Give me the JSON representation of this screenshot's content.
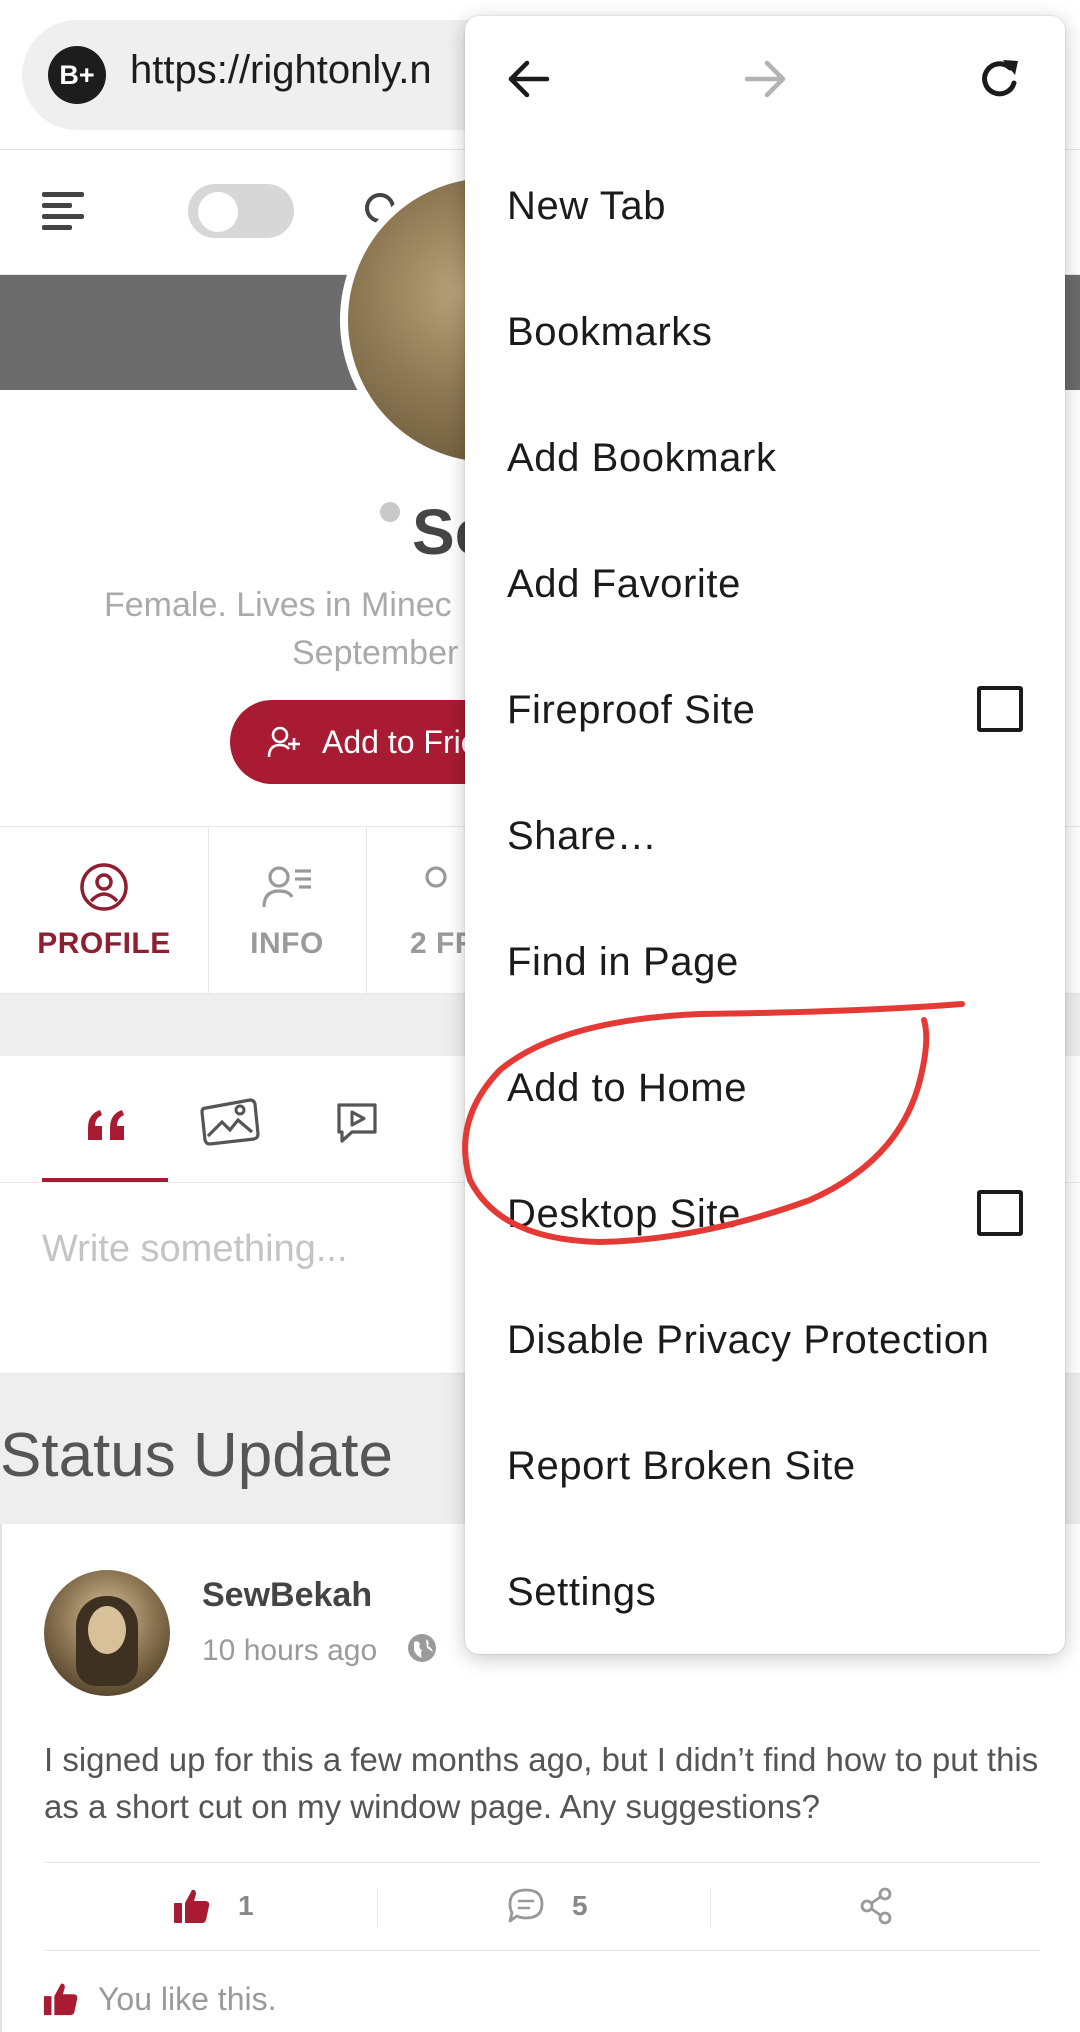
{
  "browser": {
    "badge": "B+",
    "url": "https://rightonly.n"
  },
  "profile": {
    "name_partial": "Se",
    "subtitle_line1": "Female. Lives in Minec",
    "subtitle_line2": "September",
    "add_friend_label": "Add to Frie",
    "tabs": [
      {
        "label": "PROFILE",
        "active": true
      },
      {
        "label": "INFO",
        "active": false
      },
      {
        "label": "2 FR",
        "active": false
      }
    ]
  },
  "composer": {
    "placeholder": "Write something..."
  },
  "section": {
    "title": "Status Update"
  },
  "post": {
    "author": "SewBekah",
    "time": "10 hours ago",
    "text": "I signed up for this a few months ago, but I didn’t find how to put this as a short cut on my window page. Any suggestions?",
    "likes": "1",
    "comments": "5",
    "you_like": "You like this."
  },
  "menu": {
    "items": [
      {
        "label": "New Tab"
      },
      {
        "label": "Bookmarks"
      },
      {
        "label": "Add Bookmark"
      },
      {
        "label": "Add Favorite"
      },
      {
        "label": "Fireproof Site",
        "checkbox": false
      },
      {
        "label": "Share…"
      },
      {
        "label": "Find in Page"
      },
      {
        "label": "Add to Home"
      },
      {
        "label": "Desktop Site",
        "checkbox": false
      },
      {
        "label": "Disable Privacy Protection"
      },
      {
        "label": "Report Broken Site"
      },
      {
        "label": "Settings"
      }
    ]
  },
  "colors": {
    "brand_red": "#a91b33",
    "annotation_red": "#e53935"
  }
}
